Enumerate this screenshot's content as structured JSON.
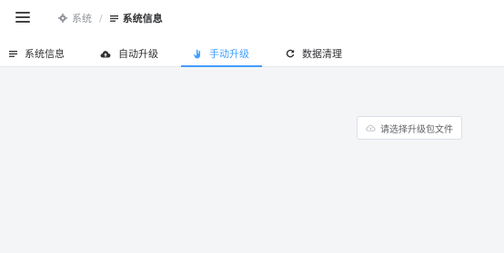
{
  "header": {
    "breadcrumb": [
      {
        "label": "系统",
        "icon": "gear-icon"
      },
      {
        "separator": "/"
      },
      {
        "label": "系统信息",
        "icon": "list-icon"
      }
    ]
  },
  "tabs": [
    {
      "label": "系统信息",
      "icon": "list-icon",
      "active": false
    },
    {
      "label": "自动升级",
      "icon": "cloud-upload-icon",
      "active": false
    },
    {
      "label": "手动升级",
      "icon": "hand-icon",
      "active": true
    },
    {
      "label": "数据清理",
      "icon": "refresh-icon",
      "active": false
    }
  ],
  "main": {
    "upload_button_label": "请选择升级包文件",
    "upload_button_icon": "cloud-icon"
  },
  "colors": {
    "accent": "#409eff",
    "background": "#f4f5f7",
    "header_background": "#ffffff"
  }
}
